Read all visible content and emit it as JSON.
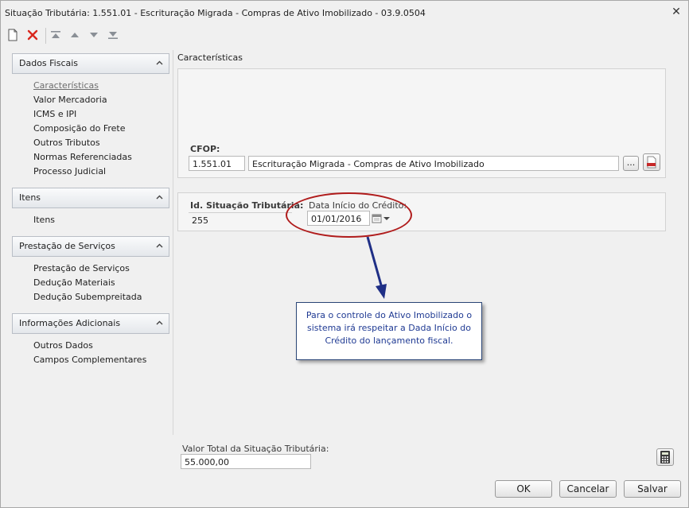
{
  "window": {
    "title": "Situação Tributária: 1.551.01 - Escrituração Migrada - Compras de Ativo Imobilizado - 03.9.0504"
  },
  "toolbar": [
    "new-icon",
    "delete-icon",
    "first-icon",
    "previous-icon",
    "next-icon",
    "last-icon"
  ],
  "sidebar": {
    "sections": [
      {
        "title": "Dados Fiscais",
        "items": [
          "Características",
          "Valor Mercadoria",
          "ICMS e IPI",
          "Composição do Frete",
          "Outros Tributos",
          "Normas Referenciadas",
          "Processo Judicial"
        ]
      },
      {
        "title": "Itens",
        "items": [
          "Itens"
        ]
      },
      {
        "title": "Prestação de Serviços",
        "items": [
          "Prestação de Serviços",
          "Dedução Materiais",
          "Dedução Subempreitada"
        ]
      },
      {
        "title": "Informações Adicionais",
        "items": [
          "Outros Dados",
          "Campos Complementares"
        ]
      }
    ]
  },
  "main": {
    "section_title": "Características",
    "cfop": {
      "label": "CFOP:",
      "code": "1.551.01",
      "description": "Escrituração Migrada - Compras de Ativo Imobilizado",
      "lookup_label": "..."
    },
    "situacao": {
      "label": "Id. Situação Tributária:",
      "value": "255"
    },
    "data_inicio": {
      "label": "Data Início do Crédito:",
      "value": "01/01/2016"
    },
    "note": "Para o controle do Ativo Imobilizado o sistema irá respeitar a Dada Início do Crédito do lançamento fiscal.",
    "total": {
      "label": "Valor Total da Situação Tributária:",
      "value": "55.000,00"
    }
  },
  "footer": {
    "ok": "OK",
    "cancel": "Cancelar",
    "save": "Salvar"
  },
  "colors": {
    "callout": "#b01c1c",
    "arrow": "#1f2f86",
    "note_text": "#1f3a93"
  }
}
